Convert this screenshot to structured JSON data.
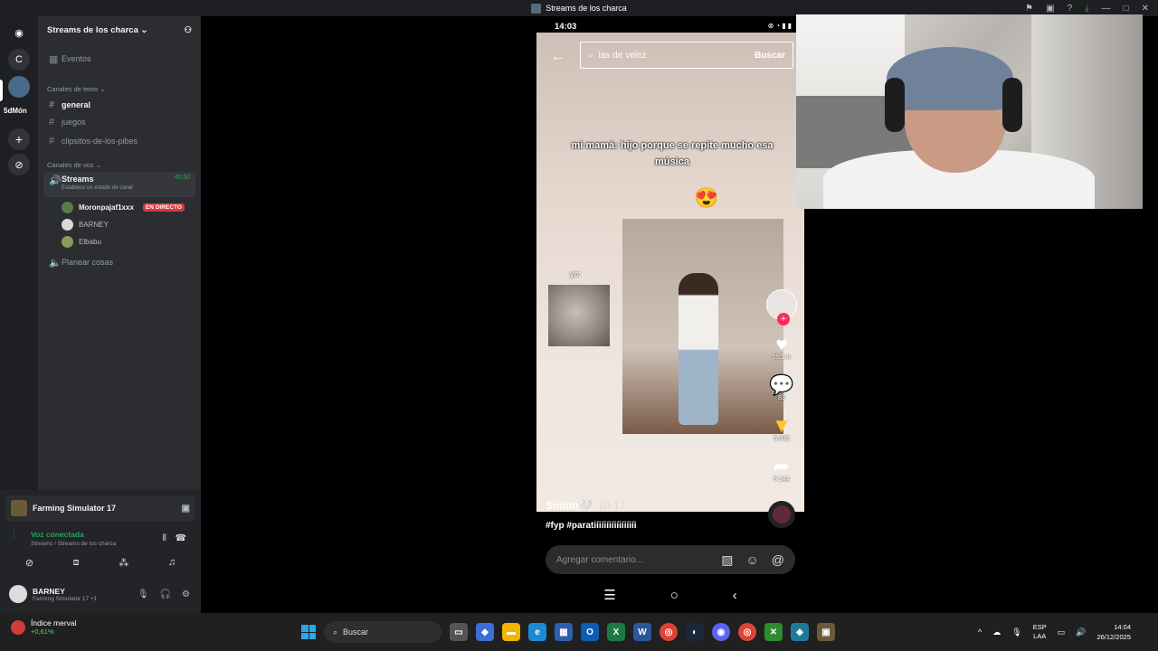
{
  "window": {
    "title": "Streams de los charca"
  },
  "servers": {
    "items": [
      {
        "label": "C"
      },
      {
        "label": "5dMón"
      }
    ]
  },
  "server": {
    "name": "Streams de los charca",
    "events_label": "Eventos"
  },
  "text_channels": {
    "category": "Canales de texto",
    "items": [
      {
        "name": "general"
      },
      {
        "name": "juegos"
      },
      {
        "name": "clipsitos-de-los-pibes"
      }
    ]
  },
  "voice_channels": {
    "category": "Canales de voz",
    "streams": {
      "name": "Streams",
      "status": "Establece un estado de canal",
      "time": "46:50"
    },
    "users": [
      {
        "name": "Moronpajaf1xxx",
        "live": "EN DIRECTO"
      },
      {
        "name": "BARNEY"
      },
      {
        "name": "Elbabu"
      }
    ],
    "other": {
      "name": "Planear cosas"
    }
  },
  "activity": {
    "name": "Farming Simulator 17"
  },
  "voice_connected": {
    "title": "Voz conectada",
    "subtitle": "Streams / Streams de los charca"
  },
  "user": {
    "name": "BARNEY",
    "status": "Farming Simulator 17 +1"
  },
  "phone": {
    "time": "14:03",
    "search": {
      "query": "las de velez",
      "button": "Buscar"
    },
    "caption": "mi mamá: hijo porque se repite mucho esa música",
    "cat_label": "yo:",
    "counts": {
      "likes": "55.1 K",
      "comments": "83",
      "saves": "5.935",
      "shares": "5.144"
    },
    "author": "Simon🤍",
    "date": "10-17",
    "hashtags": "#fyp #paratiíiíiíiíiíiíiíiíi",
    "comment_placeholder": "Agregar comentario..."
  },
  "taskbar": {
    "weather_title": "Índice merval",
    "weather_change": "+0,61%",
    "search_label": "Buscar",
    "lang_line1": "ESP",
    "lang_line2": "LAA",
    "time": "14:04",
    "date": "26/12/2025"
  },
  "colors": {
    "discord_green": "#23a55a",
    "live_red": "#da373c",
    "tiktok_pink": "#fe2c55",
    "bookmark_yellow": "#fac92c"
  }
}
